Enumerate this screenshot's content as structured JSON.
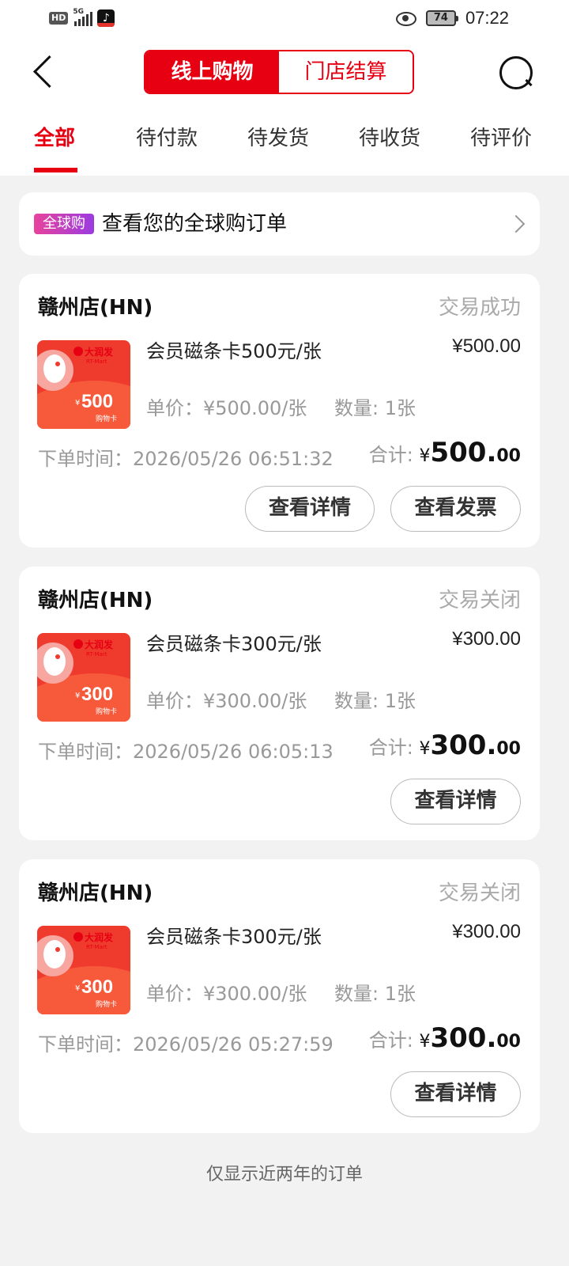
{
  "status_bar": {
    "network_badge": "HD",
    "network_type": "5G",
    "battery_level": "74",
    "time": "07:22"
  },
  "header": {
    "back_icon": "back-arrow-icon",
    "segment": {
      "online": "线上购物",
      "store": "门店结算"
    },
    "search_icon": "search-icon"
  },
  "tabs": [
    {
      "label": "全部"
    },
    {
      "label": "待付款"
    },
    {
      "label": "待发货"
    },
    {
      "label": "待收货"
    },
    {
      "label": "待评价"
    }
  ],
  "global_banner": {
    "badge": "全球购",
    "text": "查看您的全球购订单"
  },
  "card_brand": {
    "name": "大润发",
    "sub": "RT-Mart",
    "card_label": "购物卡"
  },
  "orders": [
    {
      "store": "赣州店(HN)",
      "status": "交易成功",
      "product": "会员磁条卡500元/张",
      "price": "¥500.00",
      "unit_price": "单价：¥500.00/张",
      "quantity": "数量: 1张",
      "order_time": "下单时间：2026/05/26 06:51:32",
      "total_label": "合计:",
      "currency": "¥",
      "total_int": "500.",
      "total_dec": "00",
      "card_value": "500",
      "buttons": [
        "查看详情",
        "查看发票"
      ]
    },
    {
      "store": "赣州店(HN)",
      "status": "交易关闭",
      "product": "会员磁条卡300元/张",
      "price": "¥300.00",
      "unit_price": "单价：¥300.00/张",
      "quantity": "数量: 1张",
      "order_time": "下单时间：2026/05/26 06:05:13",
      "total_label": "合计:",
      "currency": "¥",
      "total_int": "300.",
      "total_dec": "00",
      "card_value": "300",
      "buttons": [
        "查看详情"
      ]
    },
    {
      "store": "赣州店(HN)",
      "status": "交易关闭",
      "product": "会员磁条卡300元/张",
      "price": "¥300.00",
      "unit_price": "单价：¥300.00/张",
      "quantity": "数量: 1张",
      "order_time": "下单时间：2026/05/26 05:27:59",
      "total_label": "合计:",
      "currency": "¥",
      "total_int": "300.",
      "total_dec": "00",
      "card_value": "300",
      "buttons": [
        "查看详情"
      ]
    }
  ],
  "footer_note": "仅显示近两年的订单",
  "colors": {
    "accent": "#e60012",
    "muted": "#999999",
    "background": "#f2f2f2"
  }
}
